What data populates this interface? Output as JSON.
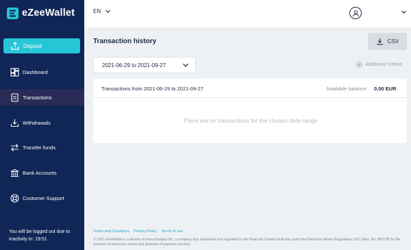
{
  "brand": {
    "name": "eZeeWallet",
    "accent": "#26c6d7",
    "sidebar_bg": "#0f2656"
  },
  "sidebar": {
    "deposit_label": "Deposit",
    "items": [
      {
        "label": "Dashboard",
        "icon": "dashboard-icon"
      },
      {
        "label": "Transactions",
        "icon": "transactions-icon",
        "active": true
      },
      {
        "label": "Withdrawals",
        "icon": "download-icon"
      },
      {
        "label": "Transfer funds",
        "icon": "transfer-icon"
      },
      {
        "label": "Bank Accounts",
        "icon": "bank-icon"
      },
      {
        "label": "Customer Support",
        "icon": "support-icon"
      }
    ],
    "logout_note": "You will be logged out due to inactivity in: 19:51"
  },
  "topbar": {
    "language": "EN"
  },
  "main": {
    "title": "Transaction history",
    "csv_label": "CSV",
    "date_range": "2021-06-29 to 2021-09-27",
    "additional_criteria": "Additional criteria",
    "card": {
      "range_text": "Transactions from 2021-06-29 to 2021-09-27",
      "balance_label": "Available balance:",
      "balance_value": "0.00 EUR",
      "empty_message": "There are no transactions for the chosen date range"
    }
  },
  "footer": {
    "links": [
      "Terms and Conditions",
      "Privacy Policy",
      "Terms of use"
    ],
    "legal": "© 2021 eZeeWallet is a division of emerchantpay ltd., a company duly authorised and regulated by the Financial Conduct Authority under the Electronic Money Regulations 2011 (Reg. No. 900778) for the issuance of electronic money and provision of payment services."
  }
}
